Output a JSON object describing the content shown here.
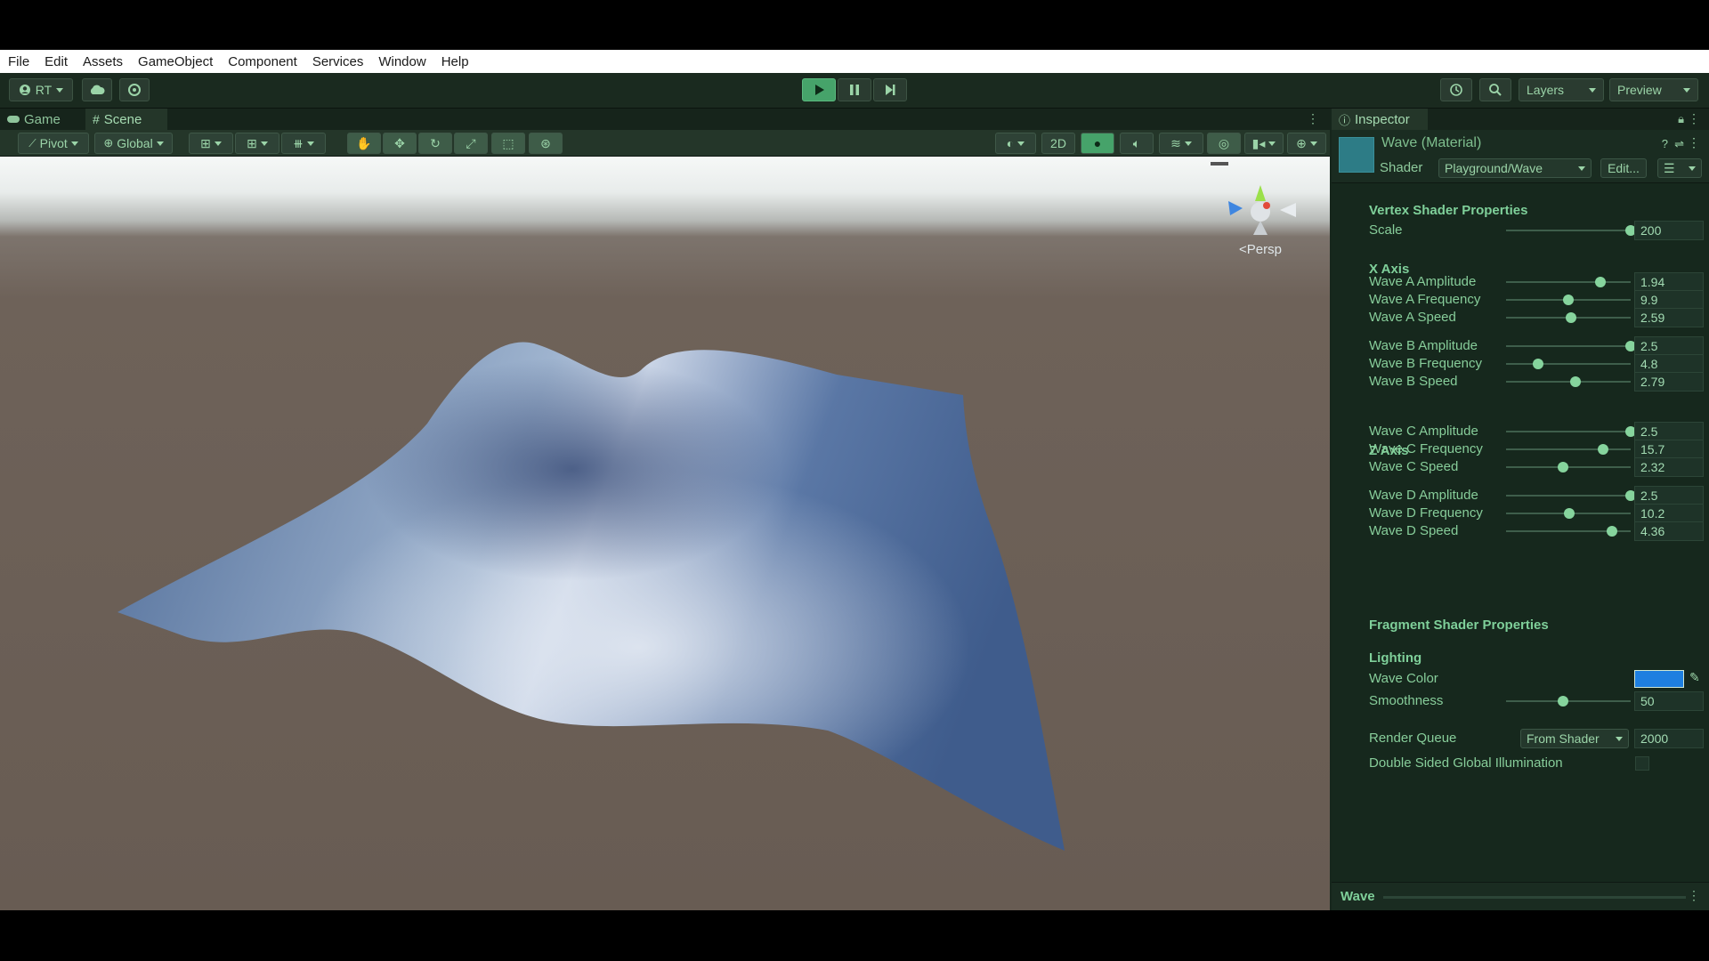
{
  "menu": [
    "File",
    "Edit",
    "Assets",
    "GameObject",
    "Component",
    "Services",
    "Window",
    "Help"
  ],
  "toolbar": {
    "account": "RT",
    "layers": "Layers",
    "preview": "Preview"
  },
  "scene": {
    "tabs": [
      "Game",
      "Scene"
    ],
    "pivot": "Pivot",
    "global": "Global",
    "mode_2d": "2D",
    "persp": "<Persp"
  },
  "inspector": {
    "tab": "Inspector",
    "material_name": "Wave (Material)",
    "shader_label": "Shader",
    "shader_value": "Playground/Wave",
    "edit_button": "Edit...",
    "sections": {
      "vertex": "Vertex Shader Properties",
      "x_axis": "X Axis",
      "z_axis": "Z Axis",
      "fragment": "Fragment Shader Properties",
      "lighting": "Lighting"
    },
    "props": [
      {
        "label": "Scale",
        "value": "200",
        "pos": 1.0
      },
      {
        "label": "Wave A Amplitude",
        "value": "1.94",
        "pos": 0.76
      },
      {
        "label": "Wave A Frequency",
        "value": "9.9",
        "pos": 0.5
      },
      {
        "label": "Wave A Speed",
        "value": "2.59",
        "pos": 0.52
      },
      {
        "label": "Wave B Amplitude",
        "value": "2.5",
        "pos": 1.0
      },
      {
        "label": "Wave B Frequency",
        "value": "4.8",
        "pos": 0.26
      },
      {
        "label": "Wave B Speed",
        "value": "2.79",
        "pos": 0.56
      },
      {
        "label": "Wave C Amplitude",
        "value": "2.5",
        "pos": 1.0
      },
      {
        "label": "Wave C Frequency",
        "value": "15.7",
        "pos": 0.78
      },
      {
        "label": "Wave C Speed",
        "value": "2.32",
        "pos": 0.46
      },
      {
        "label": "Wave D Amplitude",
        "value": "2.5",
        "pos": 1.0
      },
      {
        "label": "Wave D Frequency",
        "value": "10.2",
        "pos": 0.51
      },
      {
        "label": "Wave D Speed",
        "value": "4.36",
        "pos": 0.85
      }
    ],
    "wave_color_label": "Wave Color",
    "wave_color": "#1e7fe0",
    "smoothness": {
      "label": "Smoothness",
      "value": "50",
      "pos": 0.46
    },
    "render_queue": {
      "label": "Render Queue",
      "dropdown": "From Shader",
      "value": "2000"
    },
    "double_sided": "Double Sided Global Illumination",
    "footer": "Wave"
  }
}
